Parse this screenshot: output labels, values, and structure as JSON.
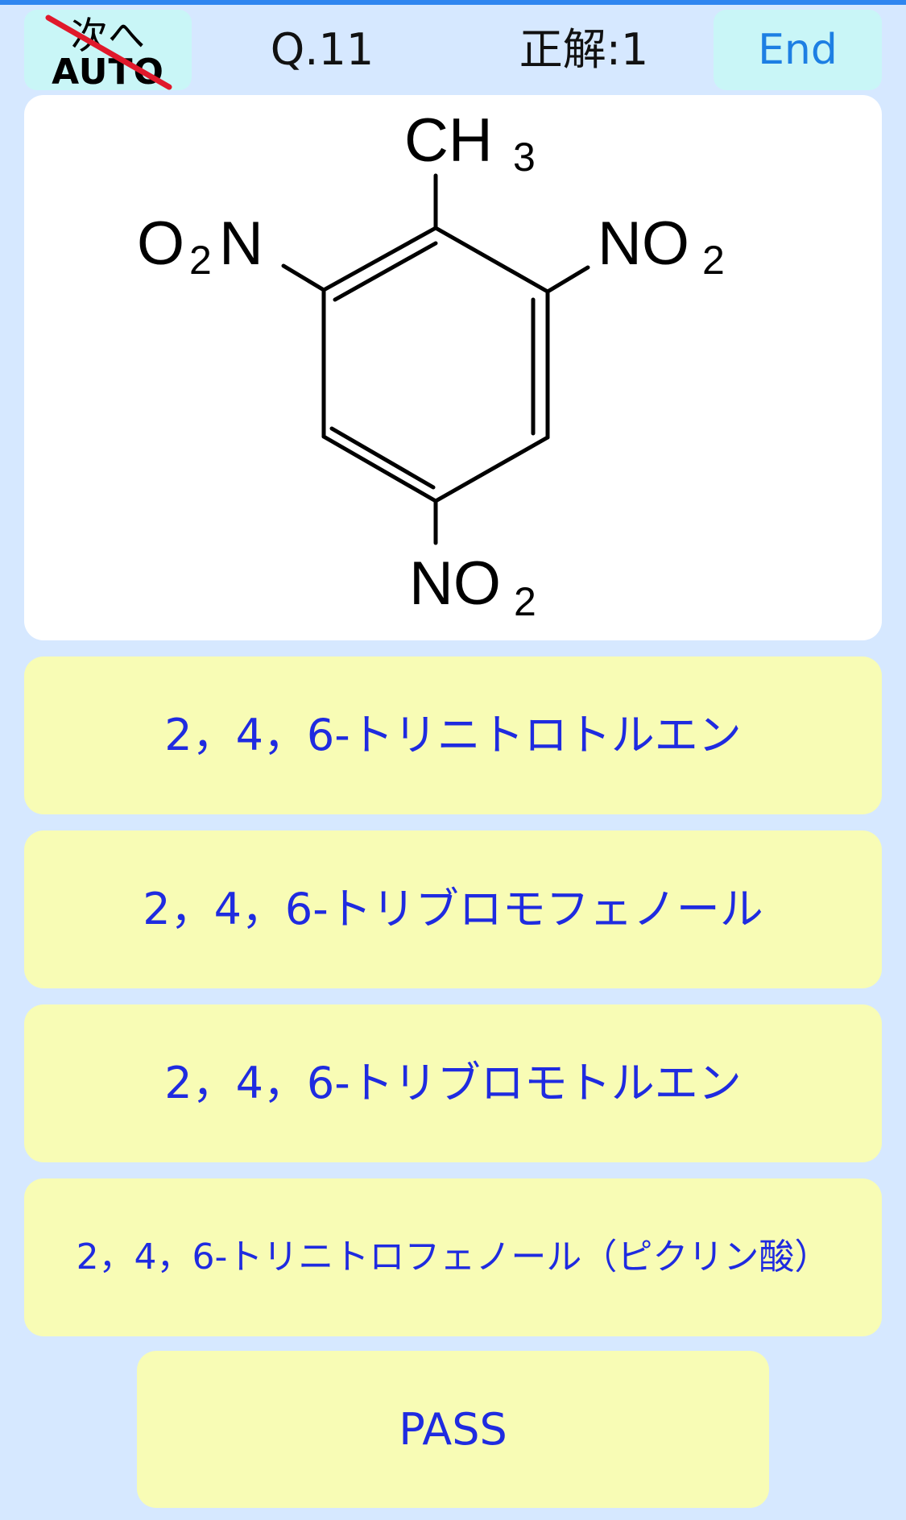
{
  "header": {
    "auto_top": "次へ",
    "auto_bottom": "AUTO",
    "question": "Q.11",
    "score": "正解:1",
    "end_label": "End"
  },
  "molecule": {
    "top_group": "CH",
    "top_sub": "3",
    "left_group_o": "O",
    "left_sub": "2",
    "left_group_n": "N",
    "right_group": "NO",
    "right_sub": "2",
    "bottom_group": "NO",
    "bottom_sub": "2"
  },
  "options": [
    "2，4，6-トリニトロトルエン",
    "2，4，6-トリブロモフェノール",
    "2，4，6-トリブロモトルエン",
    "2，4，6-トリニトロフェノール（ピクリン酸）"
  ],
  "pass_label": "PASS",
  "colors": {
    "background": "#d6e8ff",
    "button_cyan": "#c9f6f7",
    "option_yellow": "#f8fcb5",
    "option_text": "#1f2be0",
    "end_text": "#1d7fe3",
    "strike": "#e0192b"
  }
}
